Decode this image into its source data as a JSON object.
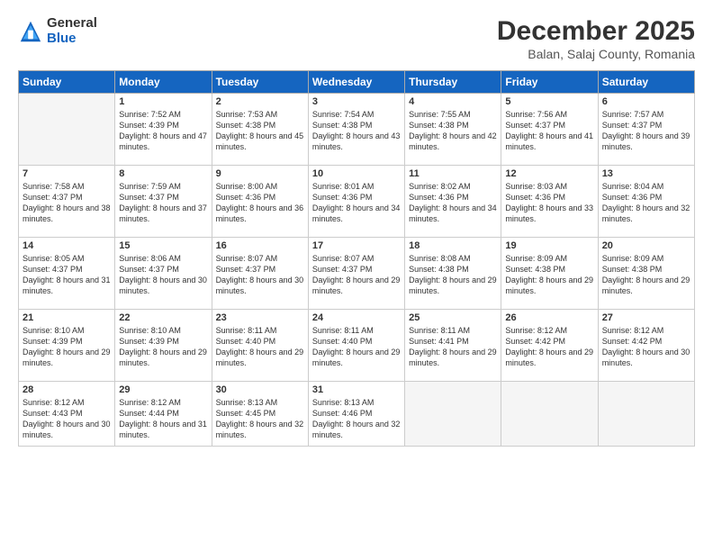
{
  "logo": {
    "general": "General",
    "blue": "Blue"
  },
  "title": "December 2025",
  "subtitle": "Balan, Salaj County, Romania",
  "days_of_week": [
    "Sunday",
    "Monday",
    "Tuesday",
    "Wednesday",
    "Thursday",
    "Friday",
    "Saturday"
  ],
  "weeks": [
    [
      {
        "day": "",
        "empty": true
      },
      {
        "day": "1",
        "sunrise": "7:52 AM",
        "sunset": "4:39 PM",
        "daylight": "8 hours and 47 minutes."
      },
      {
        "day": "2",
        "sunrise": "7:53 AM",
        "sunset": "4:38 PM",
        "daylight": "8 hours and 45 minutes."
      },
      {
        "day": "3",
        "sunrise": "7:54 AM",
        "sunset": "4:38 PM",
        "daylight": "8 hours and 43 minutes."
      },
      {
        "day": "4",
        "sunrise": "7:55 AM",
        "sunset": "4:38 PM",
        "daylight": "8 hours and 42 minutes."
      },
      {
        "day": "5",
        "sunrise": "7:56 AM",
        "sunset": "4:37 PM",
        "daylight": "8 hours and 41 minutes."
      },
      {
        "day": "6",
        "sunrise": "7:57 AM",
        "sunset": "4:37 PM",
        "daylight": "8 hours and 39 minutes."
      }
    ],
    [
      {
        "day": "7",
        "sunrise": "7:58 AM",
        "sunset": "4:37 PM",
        "daylight": "8 hours and 38 minutes."
      },
      {
        "day": "8",
        "sunrise": "7:59 AM",
        "sunset": "4:37 PM",
        "daylight": "8 hours and 37 minutes."
      },
      {
        "day": "9",
        "sunrise": "8:00 AM",
        "sunset": "4:36 PM",
        "daylight": "8 hours and 36 minutes."
      },
      {
        "day": "10",
        "sunrise": "8:01 AM",
        "sunset": "4:36 PM",
        "daylight": "8 hours and 34 minutes."
      },
      {
        "day": "11",
        "sunrise": "8:02 AM",
        "sunset": "4:36 PM",
        "daylight": "8 hours and 34 minutes."
      },
      {
        "day": "12",
        "sunrise": "8:03 AM",
        "sunset": "4:36 PM",
        "daylight": "8 hours and 33 minutes."
      },
      {
        "day": "13",
        "sunrise": "8:04 AM",
        "sunset": "4:36 PM",
        "daylight": "8 hours and 32 minutes."
      }
    ],
    [
      {
        "day": "14",
        "sunrise": "8:05 AM",
        "sunset": "4:37 PM",
        "daylight": "8 hours and 31 minutes."
      },
      {
        "day": "15",
        "sunrise": "8:06 AM",
        "sunset": "4:37 PM",
        "daylight": "8 hours and 30 minutes."
      },
      {
        "day": "16",
        "sunrise": "8:07 AM",
        "sunset": "4:37 PM",
        "daylight": "8 hours and 30 minutes."
      },
      {
        "day": "17",
        "sunrise": "8:07 AM",
        "sunset": "4:37 PM",
        "daylight": "8 hours and 29 minutes."
      },
      {
        "day": "18",
        "sunrise": "8:08 AM",
        "sunset": "4:38 PM",
        "daylight": "8 hours and 29 minutes."
      },
      {
        "day": "19",
        "sunrise": "8:09 AM",
        "sunset": "4:38 PM",
        "daylight": "8 hours and 29 minutes."
      },
      {
        "day": "20",
        "sunrise": "8:09 AM",
        "sunset": "4:38 PM",
        "daylight": "8 hours and 29 minutes."
      }
    ],
    [
      {
        "day": "21",
        "sunrise": "8:10 AM",
        "sunset": "4:39 PM",
        "daylight": "8 hours and 29 minutes."
      },
      {
        "day": "22",
        "sunrise": "8:10 AM",
        "sunset": "4:39 PM",
        "daylight": "8 hours and 29 minutes."
      },
      {
        "day": "23",
        "sunrise": "8:11 AM",
        "sunset": "4:40 PM",
        "daylight": "8 hours and 29 minutes."
      },
      {
        "day": "24",
        "sunrise": "8:11 AM",
        "sunset": "4:40 PM",
        "daylight": "8 hours and 29 minutes."
      },
      {
        "day": "25",
        "sunrise": "8:11 AM",
        "sunset": "4:41 PM",
        "daylight": "8 hours and 29 minutes."
      },
      {
        "day": "26",
        "sunrise": "8:12 AM",
        "sunset": "4:42 PM",
        "daylight": "8 hours and 29 minutes."
      },
      {
        "day": "27",
        "sunrise": "8:12 AM",
        "sunset": "4:42 PM",
        "daylight": "8 hours and 30 minutes."
      }
    ],
    [
      {
        "day": "28",
        "sunrise": "8:12 AM",
        "sunset": "4:43 PM",
        "daylight": "8 hours and 30 minutes."
      },
      {
        "day": "29",
        "sunrise": "8:12 AM",
        "sunset": "4:44 PM",
        "daylight": "8 hours and 31 minutes."
      },
      {
        "day": "30",
        "sunrise": "8:13 AM",
        "sunset": "4:45 PM",
        "daylight": "8 hours and 32 minutes."
      },
      {
        "day": "31",
        "sunrise": "8:13 AM",
        "sunset": "4:46 PM",
        "daylight": "8 hours and 32 minutes."
      },
      {
        "day": "",
        "empty": true
      },
      {
        "day": "",
        "empty": true
      },
      {
        "day": "",
        "empty": true
      }
    ]
  ],
  "labels": {
    "sunrise": "Sunrise:",
    "sunset": "Sunset:",
    "daylight": "Daylight:"
  }
}
